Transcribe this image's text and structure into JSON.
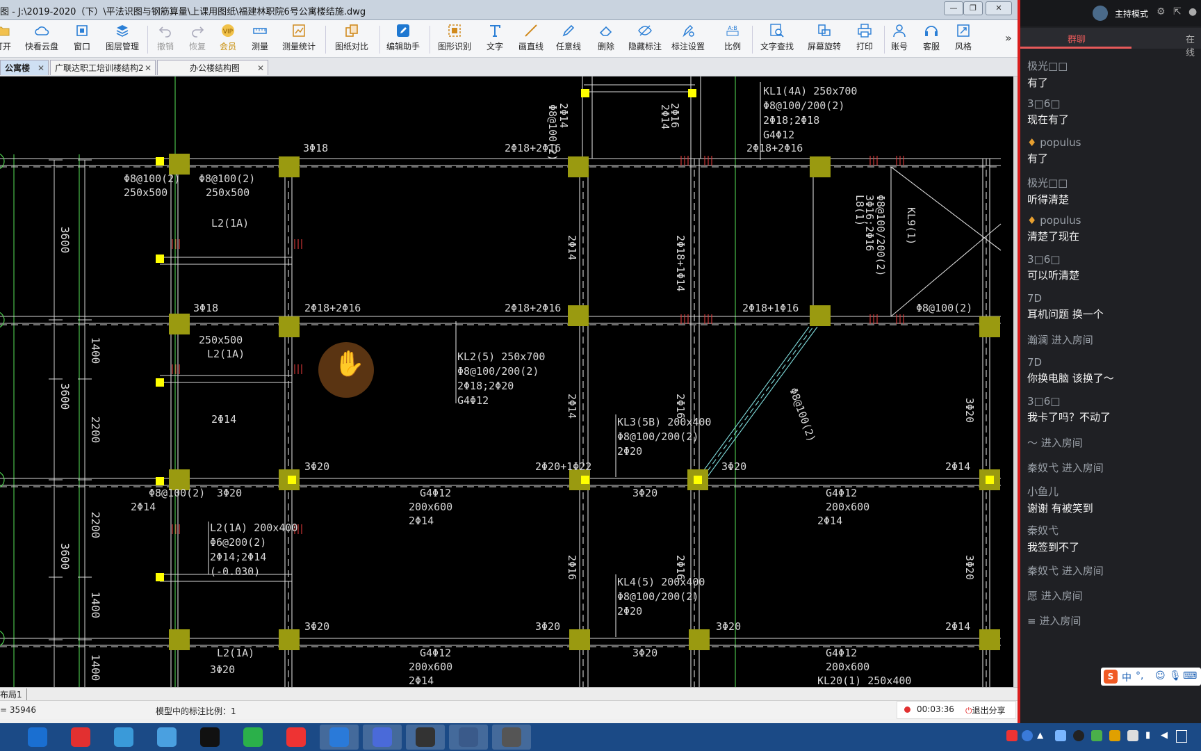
{
  "window": {
    "title": "图 - J:\\2019-2020（下）\\平法识图与钢筋算量\\上课用图纸\\福建林职院6号公寓楼结施.dwg",
    "controls": {
      "minimize": "—",
      "restore": "❐",
      "close": "✕"
    }
  },
  "toolbar": [
    {
      "label": "打开",
      "icon": "folder-icon",
      "disabled": false
    },
    {
      "label": "快看云盘",
      "icon": "cloud-icon",
      "disabled": false
    },
    {
      "label": "窗口",
      "icon": "window-icon",
      "disabled": false
    },
    {
      "label": "图层管理",
      "icon": "layers-icon",
      "disabled": false
    },
    {
      "label": "撤销",
      "icon": "undo-icon",
      "disabled": true
    },
    {
      "label": "恢复",
      "icon": "redo-icon",
      "disabled": true
    },
    {
      "label": "会员",
      "icon": "vip-icon",
      "disabled": false
    },
    {
      "label": "测量",
      "icon": "ruler-icon",
      "disabled": false
    },
    {
      "label": "测量统计",
      "icon": "measure-stats-icon",
      "disabled": false
    },
    {
      "label": "图纸对比",
      "icon": "compare-icon",
      "disabled": false
    },
    {
      "label": "编辑助手",
      "icon": "edit-assistant-icon",
      "disabled": false
    },
    {
      "label": "图形识别",
      "icon": "shape-recognition-icon",
      "disabled": false
    },
    {
      "label": "文字",
      "icon": "text-icon",
      "disabled": false
    },
    {
      "label": "画直线",
      "icon": "line-icon",
      "disabled": false
    },
    {
      "label": "任意线",
      "icon": "pen-icon",
      "disabled": false
    },
    {
      "label": "删除",
      "icon": "eraser-icon",
      "disabled": false
    },
    {
      "label": "隐藏标注",
      "icon": "hide-icon",
      "disabled": false
    },
    {
      "label": "标注设置",
      "icon": "annotation-settings-icon",
      "disabled": false
    },
    {
      "label": "比例",
      "icon": "scale-icon",
      "disabled": false
    },
    {
      "label": "文字查找",
      "icon": "text-search-icon",
      "disabled": false
    },
    {
      "label": "屏幕旋转",
      "icon": "rotate-icon",
      "disabled": false
    },
    {
      "label": "打印",
      "icon": "print-icon",
      "disabled": false
    },
    {
      "label": "账号",
      "icon": "user-icon",
      "disabled": false
    },
    {
      "label": "客服",
      "icon": "headset-icon",
      "disabled": false
    },
    {
      "label": "风格",
      "icon": "style-icon",
      "disabled": false
    }
  ],
  "toolbar_more": "»",
  "tabs": [
    {
      "label": "公寓楼",
      "active": true
    },
    {
      "label": "广联达职工培训楼结构2",
      "active": false
    },
    {
      "label": "办公楼结构图",
      "active": false
    }
  ],
  "tab_close": "✕",
  "drawing": {
    "dims": [
      "3600",
      "1400",
      "3600",
      "2200",
      "2200",
      "3600",
      "1400",
      "1400"
    ],
    "beam_labels": [
      {
        "lines": [
          "KL1(4A) 250x700",
          "Φ8@100/200(2)",
          "2Φ18;2Φ18",
          "G4Φ12"
        ]
      },
      {
        "lines": [
          "KL2(5) 250x700",
          "Φ8@100/200(2)",
          "2Φ18;2Φ20",
          "G4Φ12"
        ]
      },
      {
        "lines": [
          "KL3(5B) 200x400",
          "Φ8@100/200(2)",
          "2Φ20"
        ]
      },
      {
        "lines": [
          "KL4(5) 200x400",
          "Φ8@100/200(2)",
          "2Φ20"
        ]
      },
      {
        "lines": [
          "L2(1A) 200x400",
          "Φ6@200(2)",
          "2Φ14;2Φ14",
          "(-0.030)"
        ]
      }
    ],
    "texts": [
      "Φ8@100(2)",
      "250x500",
      "Φ8@100(2)",
      "250x500",
      "L2(1A)",
      "3Φ18",
      "2Φ18+2Φ16",
      "2Φ18+2Φ16",
      "Φ8@100(2)",
      "2Φ14",
      "2Φ14",
      "2Φ16",
      "2Φ14",
      "2Φ18+1Φ14",
      "3Φ18",
      "2Φ18+2Φ16",
      "2Φ18+2Φ16",
      "2Φ18+1Φ16",
      "Φ8@100(2)",
      "250x500",
      "L2(1A)",
      "2Φ14",
      "2Φ14",
      "2Φ16",
      "3Φ20",
      "3Φ20",
      "2Φ20+1Φ22",
      "3Φ20",
      "2Φ14",
      "Φ8@100(2)",
      "2Φ14",
      "3Φ20",
      "G4Φ12",
      "200x600",
      "2Φ14",
      "3Φ20",
      "G4Φ12",
      "200x600",
      "2Φ14",
      "2Φ16",
      "2Φ16",
      "3Φ20",
      "3Φ20",
      "3Φ20",
      "3Φ20",
      "2Φ14",
      "L2(1A)",
      "3Φ20",
      "G4Φ12",
      "200x600",
      "2Φ14",
      "3Φ20",
      "G4Φ12",
      "200x600",
      "KL20(1) 250x400",
      "Φ8@100/200(2)",
      "3Φ16;2Φ16",
      "L8(1)",
      "KL9(1)",
      "Φ8@100(2)",
      "2Φ14",
      "Φ8@100(2)",
      "2Φ14"
    ]
  },
  "layout_tab": "布局1",
  "status": {
    "coord": "= 35946",
    "scale": "模型中的标注比例：1",
    "timer": "00:03:36",
    "exit": "退出分享"
  },
  "rightpanel": {
    "mode": "主持模式",
    "tabs": [
      "群聊",
      "在线"
    ],
    "messages": [
      {
        "name": "极光□□",
        "text": "有了",
        "host": false
      },
      {
        "name": "3□6□",
        "text": "现在有了",
        "host": false
      },
      {
        "name": "populus",
        "text": "有了",
        "host": true
      },
      {
        "name": "极光□□",
        "text": "听得清楚",
        "host": false
      },
      {
        "name": "populus",
        "text": "清楚了现在",
        "host": true
      },
      {
        "name": "3□6□",
        "text": "可以听清楚",
        "host": false
      },
      {
        "name": "7D",
        "text": "耳机问题 换一个",
        "host": false
      },
      {
        "system": "瀚澜 进入房间"
      },
      {
        "name": "7D",
        "text": "你换电脑 该换了～",
        "host": false
      },
      {
        "name": "3□6□",
        "text": "我卡了吗？不动了",
        "host": false
      },
      {
        "system": "～ 进入房间"
      },
      {
        "system": "秦奴弋 进入房间"
      },
      {
        "name": "小鱼儿",
        "text": "谢谢 有被笑到",
        "host": false
      },
      {
        "name": "秦奴弋",
        "text": "我签到不了",
        "host": false
      },
      {
        "system": "秦奴弋 进入房间"
      },
      {
        "system": "愿 进入房间"
      },
      {
        "system": "≡ 进入房间"
      }
    ],
    "ime": "中",
    "ime_symbols": "°,"
  },
  "taskbar": {
    "items": [
      "explorer",
      "netease-music",
      "baidu-netdisk",
      "pinwheel",
      "qq",
      "wechat",
      "jiang",
      "study",
      "pdf",
      "cad",
      "graduation",
      "ke"
    ]
  },
  "colors": {
    "host": "#e8a030",
    "recording": "#e23030",
    "accent": "#d91e1e"
  }
}
